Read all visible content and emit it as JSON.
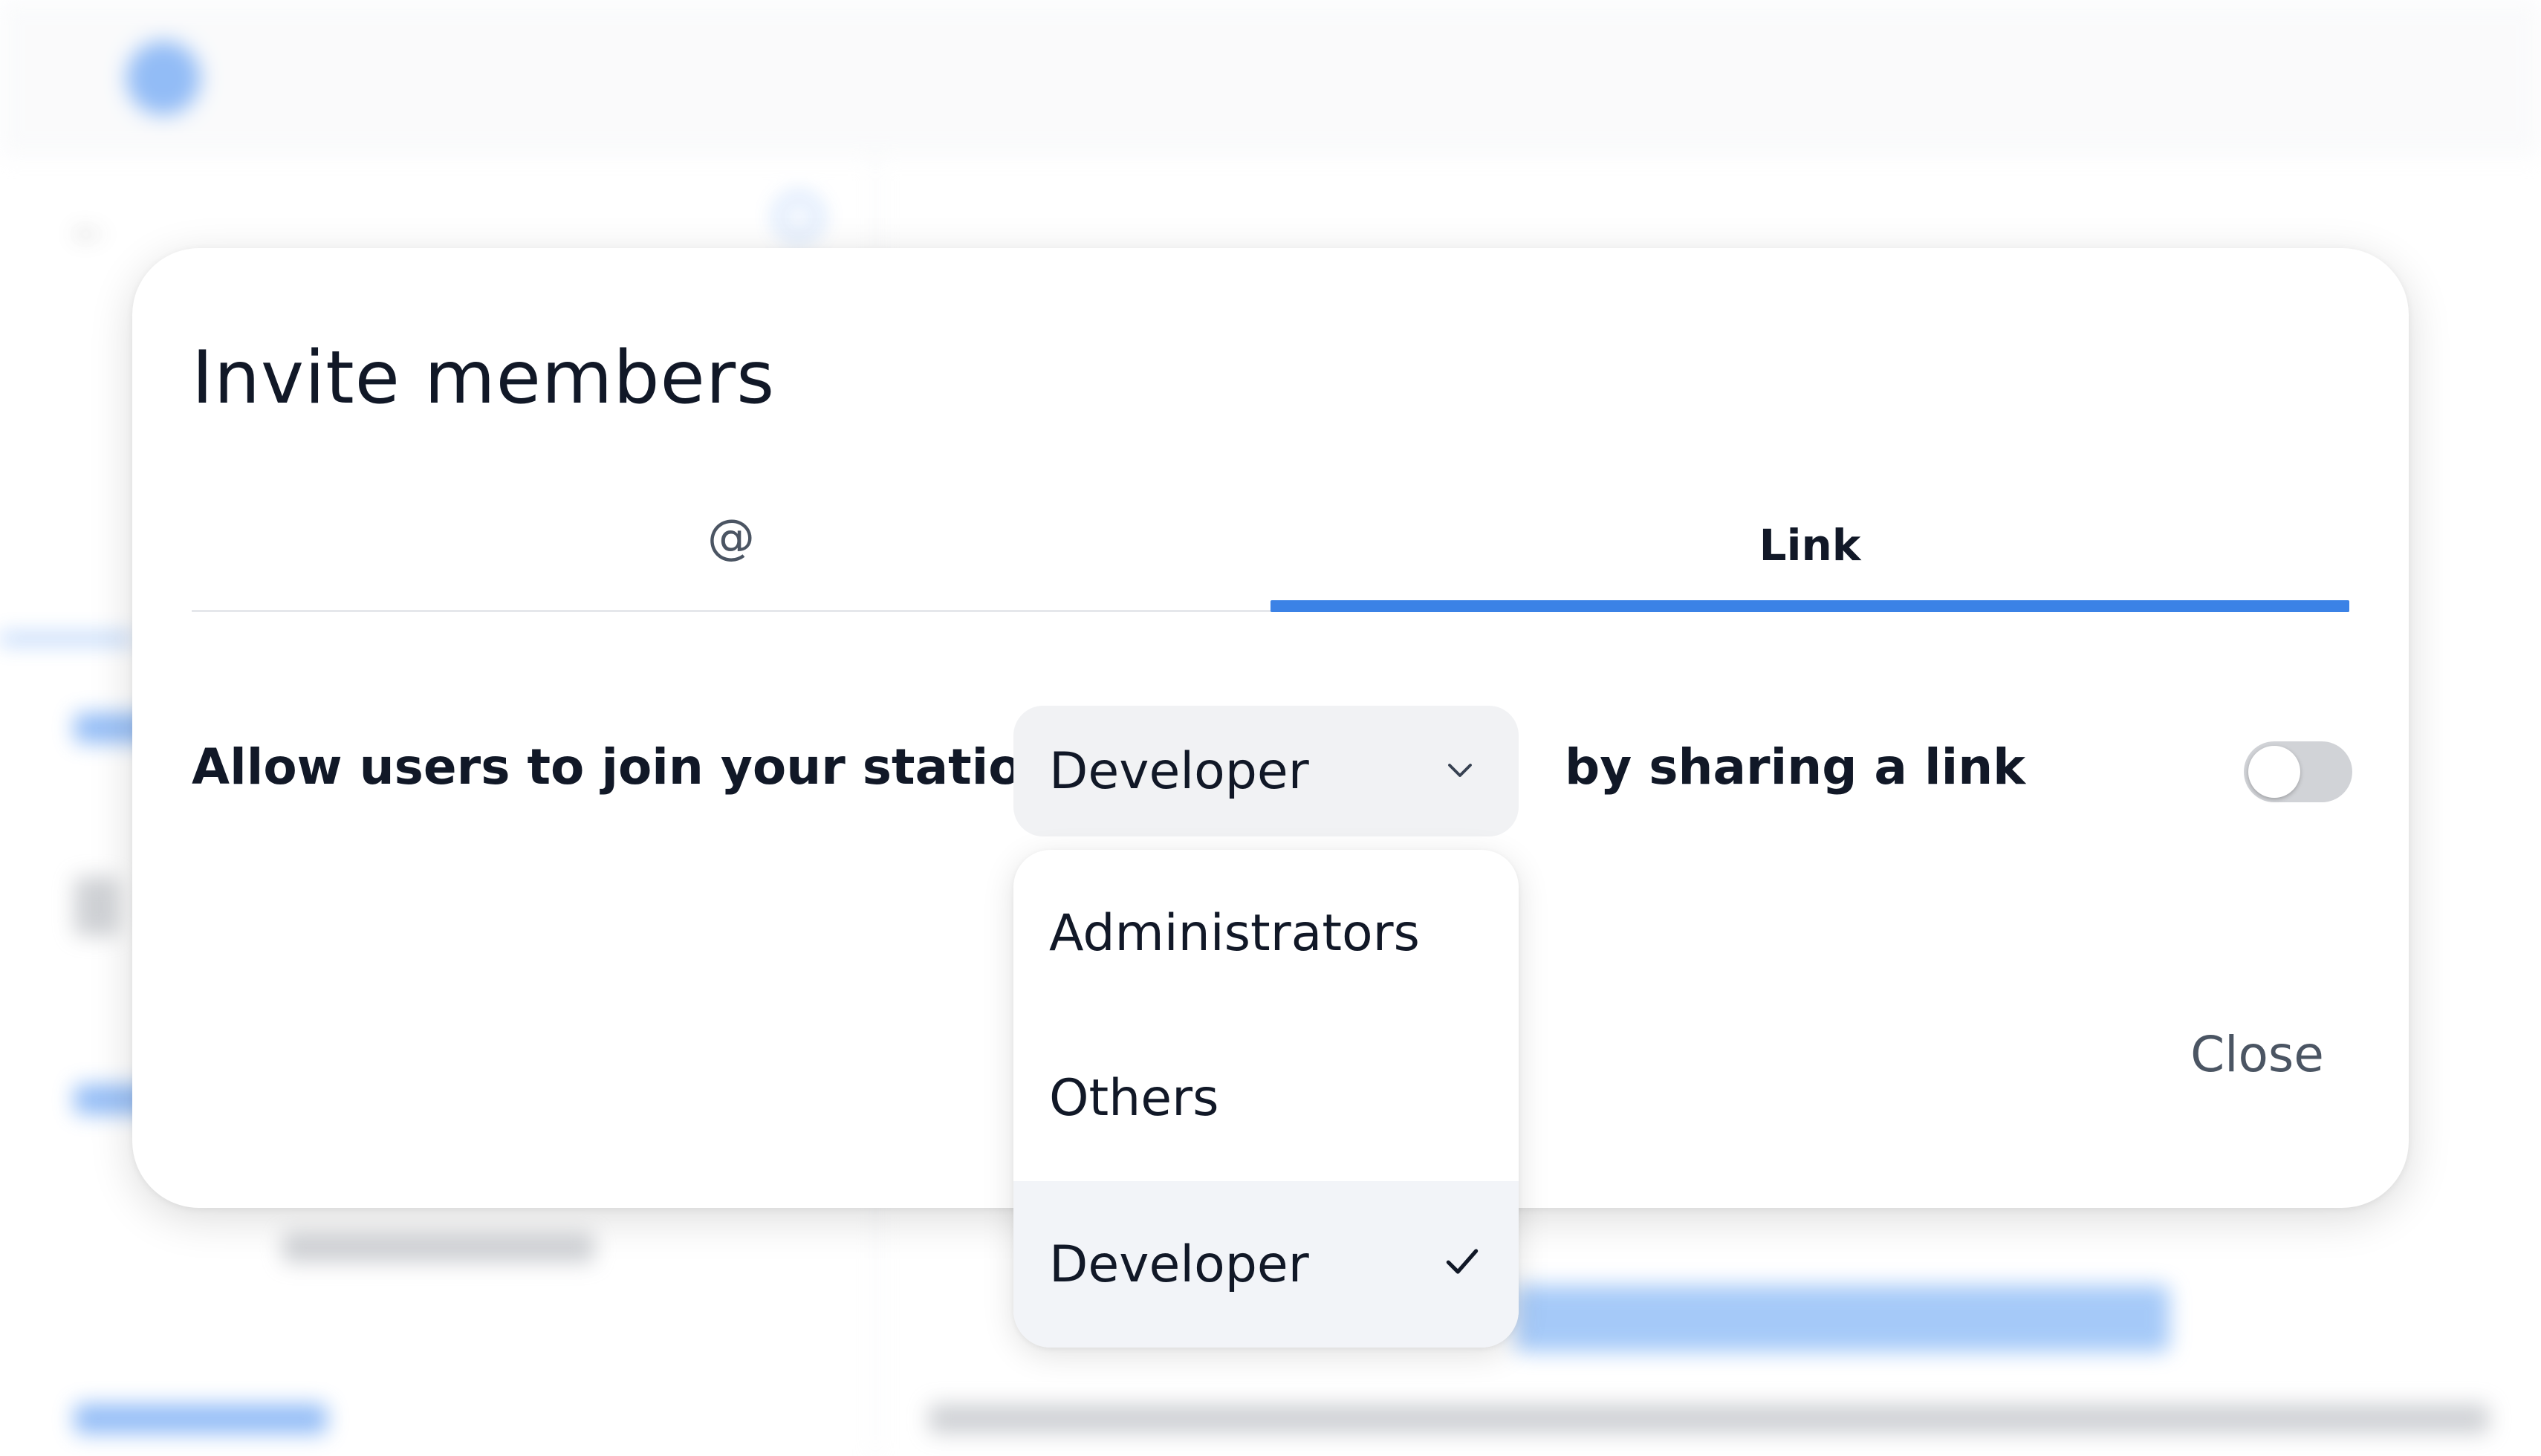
{
  "background": {
    "brand_color": "#3a86f0"
  },
  "modal": {
    "title": "Invite members",
    "tabs": [
      {
        "label": "@",
        "icon": "at-icon",
        "selected": false
      },
      {
        "label": "Link",
        "selected": true
      }
    ],
    "row": {
      "prefix": "Allow users to join your station as",
      "selected_role": "Developer",
      "suffix": "by sharing a link",
      "toggle_on": false
    },
    "close_label": "Close",
    "accent_color": "#3b82e6"
  },
  "dropdown": {
    "options": [
      {
        "label": "Administrators",
        "selected": false
      },
      {
        "label": "Others",
        "selected": false
      },
      {
        "label": "Developer",
        "selected": true
      }
    ]
  }
}
